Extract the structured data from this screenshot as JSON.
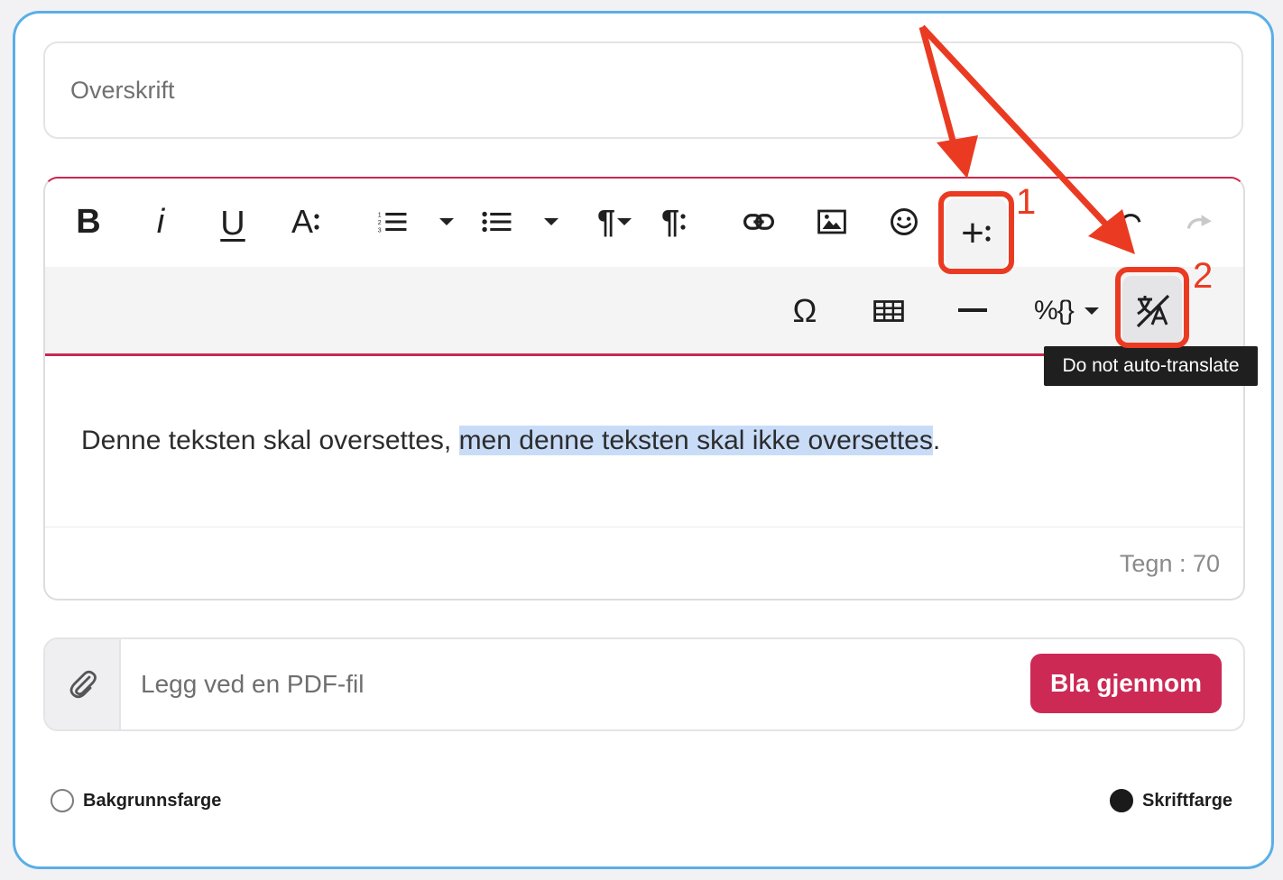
{
  "title_field": {
    "placeholder": "Overskrift"
  },
  "toolbar": {
    "row1": [
      {
        "name": "bold",
        "glyph": "B"
      },
      {
        "name": "italic",
        "glyph": "i"
      },
      {
        "name": "underline",
        "glyph": "U"
      },
      {
        "name": "font-size",
        "glyph": "A"
      },
      {
        "name": "ordered-list",
        "glyph": "ordered-list-icon"
      },
      {
        "name": "bullet-list",
        "glyph": "bullet-list-icon"
      },
      {
        "name": "paragraph",
        "glyph": "¶"
      },
      {
        "name": "paragraph-format",
        "glyph": "¶"
      },
      {
        "name": "link",
        "glyph": "link-icon"
      },
      {
        "name": "image",
        "glyph": "image-icon"
      },
      {
        "name": "emoji",
        "glyph": "smiley-icon"
      },
      {
        "name": "more-insert",
        "glyph": "+"
      },
      {
        "name": "undo",
        "glyph": "undo-icon"
      },
      {
        "name": "redo",
        "glyph": "redo-icon"
      }
    ],
    "row2": [
      {
        "name": "special-characters",
        "glyph": "Ω"
      },
      {
        "name": "table",
        "glyph": "table-icon"
      },
      {
        "name": "horizontal-line",
        "glyph": "minus-icon"
      },
      {
        "name": "variables",
        "glyph": "%{}"
      },
      {
        "name": "do-not-translate",
        "glyph": "no-translate-icon"
      }
    ]
  },
  "tooltip": "Do not auto-translate",
  "content": {
    "plain": "Denne teksten skal oversettes, ",
    "selected": "men denne teksten skal ikke oversettes",
    "tail": "."
  },
  "counter": "Tegn : 70",
  "attachment": {
    "placeholder": "Legg ved en PDF-fil",
    "button": "Bla gjennom"
  },
  "colors": {
    "background_label": "Bakgrunnsfarge",
    "font_label": "Skriftfarge",
    "background_value": "#ffffff",
    "font_value": "#1a1a1a",
    "accent": "#cc2a55",
    "annotation": "#ea3b22"
  },
  "annotations": {
    "label1": "1",
    "label2": "2"
  }
}
